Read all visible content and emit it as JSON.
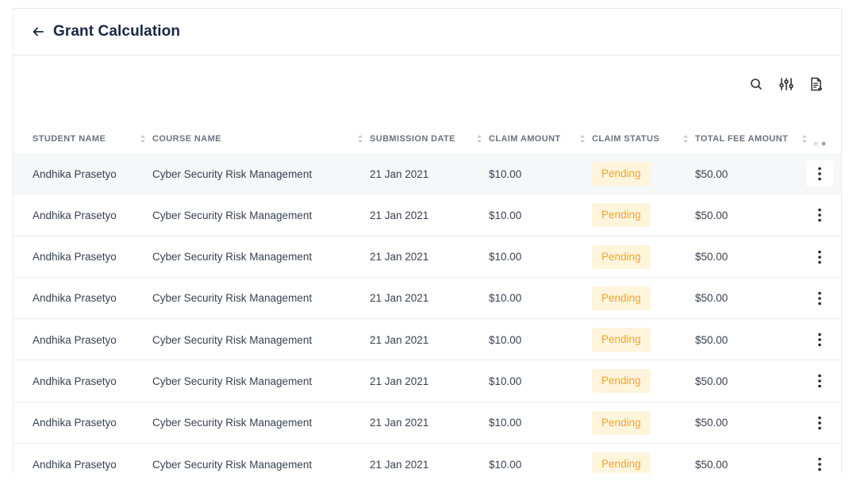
{
  "header": {
    "title": "Grant Calculation",
    "back_icon": "arrow-left-icon"
  },
  "toolbar": {
    "icons": [
      "search-icon",
      "filter-sliders-icon",
      "export-document-icon"
    ]
  },
  "table": {
    "columns": {
      "student": "STUDENT NAME",
      "course": "COURSE NAME",
      "date": "SUBMISSION DATE",
      "claim": "CLAIM AMOUNT",
      "status": "CLAIM STATUS",
      "fee": "TOTAL FEE AMOUNT"
    },
    "rows": [
      {
        "student": "Andhika Prasetyo",
        "course": "Cyber Security Risk Management",
        "date": "21 Jan 2021",
        "claim": "$10.00",
        "status": "Pending",
        "fee": "$50.00"
      },
      {
        "student": "Andhika Prasetyo",
        "course": "Cyber Security Risk Management",
        "date": "21 Jan 2021",
        "claim": "$10.00",
        "status": "Pending",
        "fee": "$50.00"
      },
      {
        "student": "Andhika Prasetyo",
        "course": "Cyber Security Risk Management",
        "date": "21 Jan 2021",
        "claim": "$10.00",
        "status": "Pending",
        "fee": "$50.00"
      },
      {
        "student": "Andhika Prasetyo",
        "course": "Cyber Security Risk Management",
        "date": "21 Jan 2021",
        "claim": "$10.00",
        "status": "Pending",
        "fee": "$50.00"
      },
      {
        "student": "Andhika Prasetyo",
        "course": "Cyber Security Risk Management",
        "date": "21 Jan 2021",
        "claim": "$10.00",
        "status": "Pending",
        "fee": "$50.00"
      },
      {
        "student": "Andhika Prasetyo",
        "course": "Cyber Security Risk Management",
        "date": "21 Jan 2021",
        "claim": "$10.00",
        "status": "Pending",
        "fee": "$50.00"
      },
      {
        "student": "Andhika Prasetyo",
        "course": "Cyber Security Risk Management",
        "date": "21 Jan 2021",
        "claim": "$10.00",
        "status": "Pending",
        "fee": "$50.00"
      },
      {
        "student": "Andhika Prasetyo",
        "course": "Cyber Security Risk Management",
        "date": "21 Jan 2021",
        "claim": "$10.00",
        "status": "Pending",
        "fee": "$50.00"
      }
    ]
  },
  "colors": {
    "title": "#1a2745",
    "pending_text": "#f5a524",
    "pending_bg": "#fff4dc",
    "row_hover": "#f6f7f9"
  }
}
